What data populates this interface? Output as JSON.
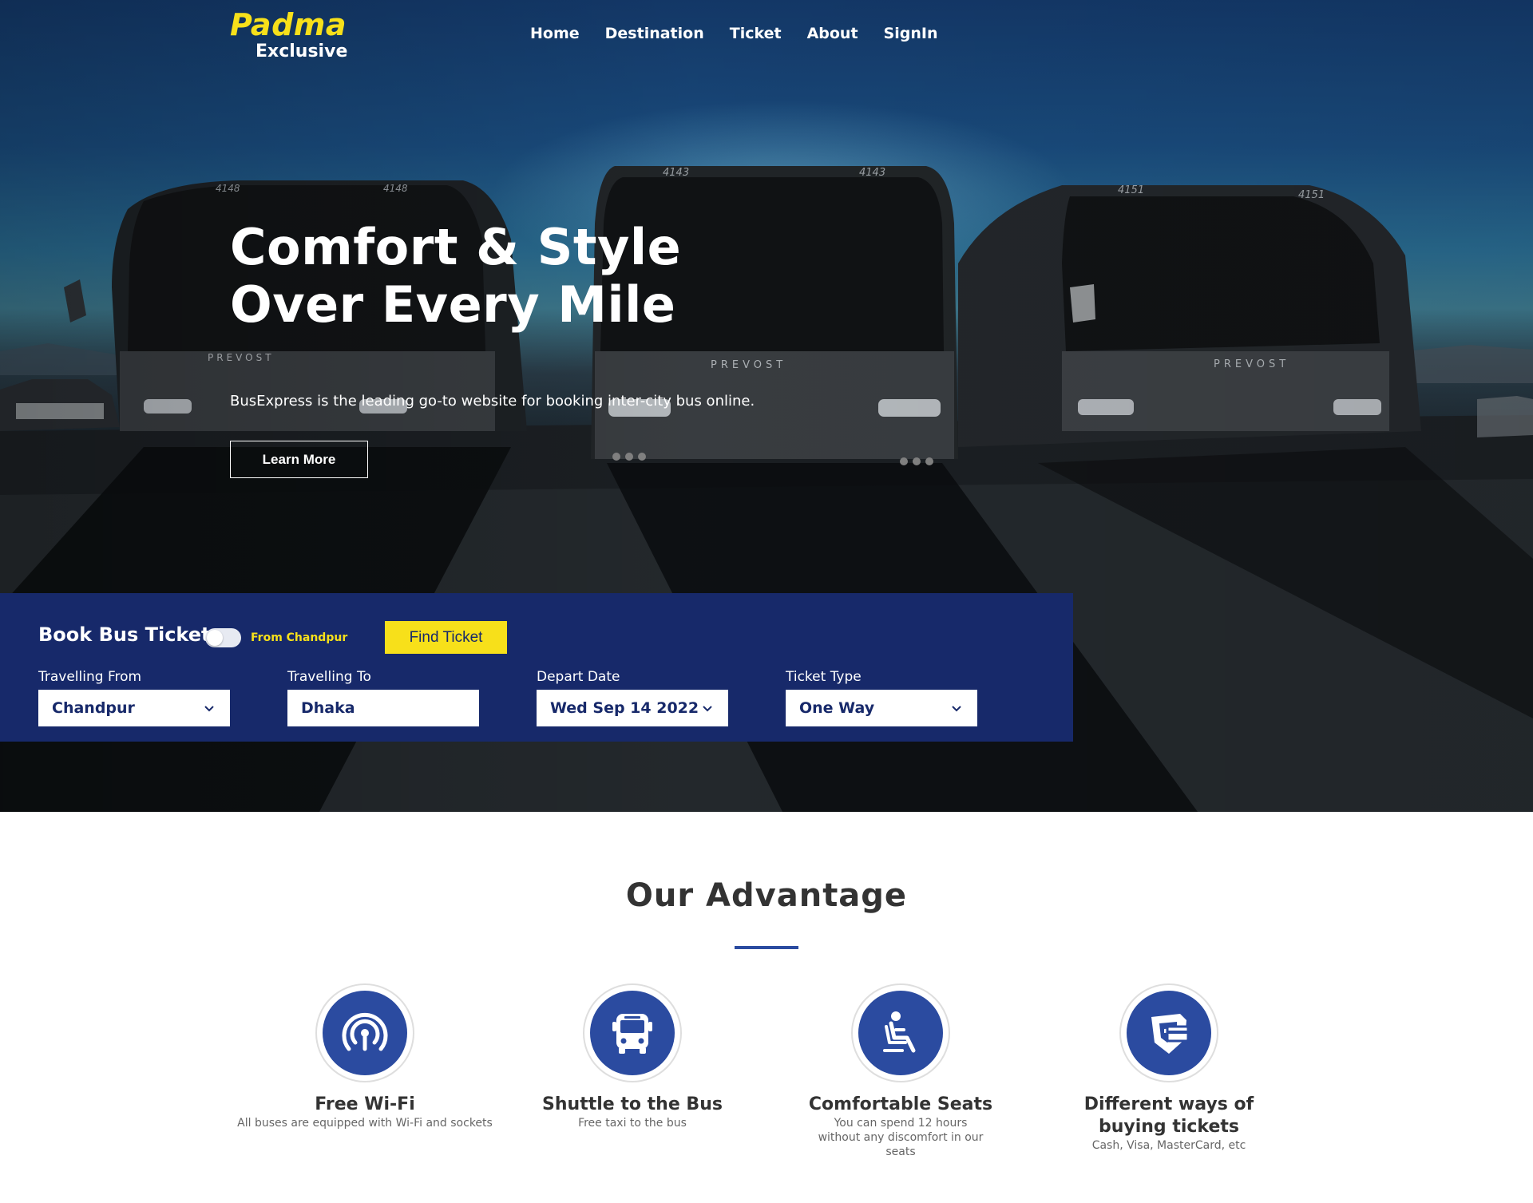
{
  "brand": {
    "name": "Padma",
    "tagline": "Exclusive"
  },
  "nav": {
    "items": [
      "Home",
      "Destination",
      "Ticket",
      "About",
      "SignIn"
    ]
  },
  "hero": {
    "title_line1": "Comfort & Style",
    "title_line2": "Over Every Mile",
    "subtitle": "BusExpress is the leading go-to website for booking inter-city bus online.",
    "button_label": "Learn More",
    "bus_numbers": [
      "4148",
      "4143",
      "4151"
    ],
    "bus_make": "PREVOST"
  },
  "booking": {
    "title": "Book Bus Ticket",
    "toggle_on": false,
    "toggle_label": "From Chandpur",
    "find_label": "Find Ticket",
    "fields": [
      {
        "label": "Travelling From",
        "value": "Chandpur",
        "type": "select"
      },
      {
        "label": "Travelling To",
        "value": "Dhaka",
        "type": "input"
      },
      {
        "label": "Depart Date",
        "value": "Wed Sep 14 2022",
        "type": "select"
      },
      {
        "label": "Ticket Type",
        "value": "One Way",
        "type": "select"
      }
    ]
  },
  "advantage": {
    "title": "Our Advantage",
    "features": [
      {
        "icon": "wifi-icon",
        "title": "Free Wi-Fi",
        "desc": "All buses are equipped with Wi-Fi and sockets"
      },
      {
        "icon": "bus-icon",
        "title": "Shuttle to the Bus",
        "desc": "Free taxi to the bus"
      },
      {
        "icon": "seat-icon",
        "title": "Comfortable Seats",
        "desc": "You can spend 12 hours without any discomfort in our seats"
      },
      {
        "icon": "payment-shield-icon",
        "title": "Different ways of buying tickets",
        "desc": "Cash, Visa, MasterCard, etc"
      }
    ]
  },
  "colors": {
    "accent_yellow": "#f7e01a",
    "panel_navy": "#17296a",
    "icon_blue": "#2b4ba0"
  }
}
